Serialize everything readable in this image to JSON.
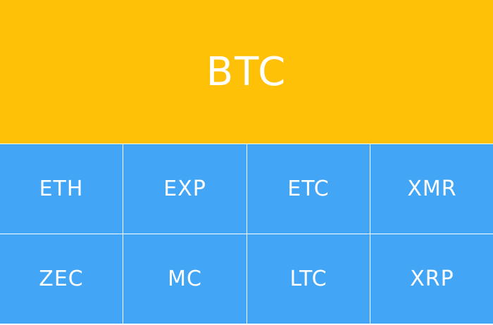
{
  "hero": {
    "label": "BTC",
    "color": "#ffc107"
  },
  "tiles": [
    {
      "label": "ETH"
    },
    {
      "label": "EXP"
    },
    {
      "label": "ETC"
    },
    {
      "label": "XMR"
    },
    {
      "label": "ZEC"
    },
    {
      "label": "MC"
    },
    {
      "label": "LTC"
    },
    {
      "label": "XRP"
    }
  ],
  "tile_color": "#42a5f5",
  "text_color": "#ffffff"
}
